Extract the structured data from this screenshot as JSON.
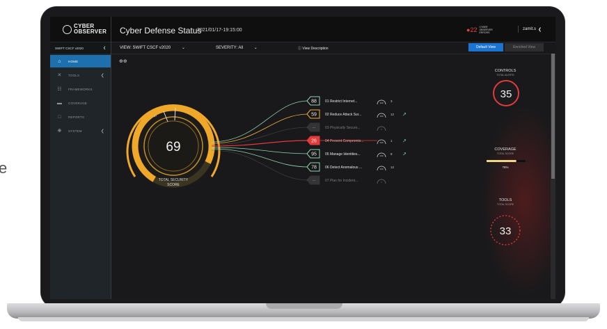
{
  "partial_text": "e",
  "header": {
    "logo": [
      "CYBER",
      "OBSERVER"
    ],
    "title": "Cyber Defense Status",
    "timestamp": "2021/01/17-19:15:00",
    "errors_count": "22",
    "errors_label": "CYBER OBSERVER ERRORS",
    "user": "zamit.s"
  },
  "sidebar": {
    "filter": "SWIFT CSCF v2020",
    "items": [
      {
        "label": "HOME",
        "icon": "home-icon",
        "active": true
      },
      {
        "label": "TOOLS",
        "icon": "tools-icon",
        "chevron": true
      },
      {
        "label": "FRAMEWORKS",
        "icon": "frameworks-icon"
      },
      {
        "label": "COVERAGE",
        "icon": "coverage-icon"
      },
      {
        "label": "REPORTS",
        "icon": "reports-icon"
      },
      {
        "label": "SYSTEM",
        "icon": "system-icon",
        "chevron": true
      }
    ]
  },
  "viewbar": {
    "view": "VIEW: SWIFT CSCF v2020",
    "severity": "SEVERITY: All",
    "view_description": "View Description",
    "default_view": "Default View",
    "enriched_view": "Enriched View"
  },
  "score": {
    "value": "69",
    "label_line1": "TOTAL SECURITY",
    "label_line2": "SCORE",
    "tick_label": "41"
  },
  "controls": [
    {
      "score": "88",
      "label": "01 Restrict Internet...",
      "gauge": "100",
      "count": "3",
      "trend": "",
      "color": "#8fd6b0",
      "dim": false
    },
    {
      "score": "59",
      "label": "02 Reduce Attack Sur...",
      "gauge": "100",
      "count": "12",
      "trend": "up",
      "color": "#f0b23a",
      "dim": false
    },
    {
      "score": "--",
      "label": "03 Physically Secure...",
      "gauge": "0",
      "count": "",
      "trend": "",
      "color": "#6b6b6d",
      "dim": true
    },
    {
      "score": "26",
      "label": "04 Prevent Compromis...",
      "gauge": "100",
      "count": "1",
      "trend": "up",
      "color": "#e23b3b",
      "dim": false
    },
    {
      "score": "95",
      "label": "05 Manage Identities...",
      "gauge": "100",
      "count": "8",
      "trend": "up",
      "color": "#8fd6b0",
      "dim": false
    },
    {
      "score": "78",
      "label": "06 Detect Anomalous ...",
      "gauge": "100",
      "count": "12",
      "trend": "",
      "color": "#8fd6b0",
      "dim": false
    },
    {
      "score": "--",
      "label": "07 Plan for Incident...",
      "gauge": "0",
      "count": "",
      "trend": "",
      "color": "#6b6b6d",
      "dim": true
    }
  ],
  "right_panel": {
    "controls_title": "CONTROLS",
    "controls_sub": "TOTAL ALERTS",
    "controls_value": "35",
    "coverage_title": "COVERAGE",
    "coverage_sub": "TOTAL SCORE",
    "coverage_value": "76%",
    "coverage_fraction": 0.76,
    "tools_title": "TOOLS",
    "tools_sub": "TOTAL SCORE",
    "tools_value": "33"
  },
  "colors": {
    "accent_blue": "#1b73d2",
    "gauge_orange": "#f0a82a",
    "alert_red": "#e23b3b",
    "good_green": "#8fd6b0"
  }
}
